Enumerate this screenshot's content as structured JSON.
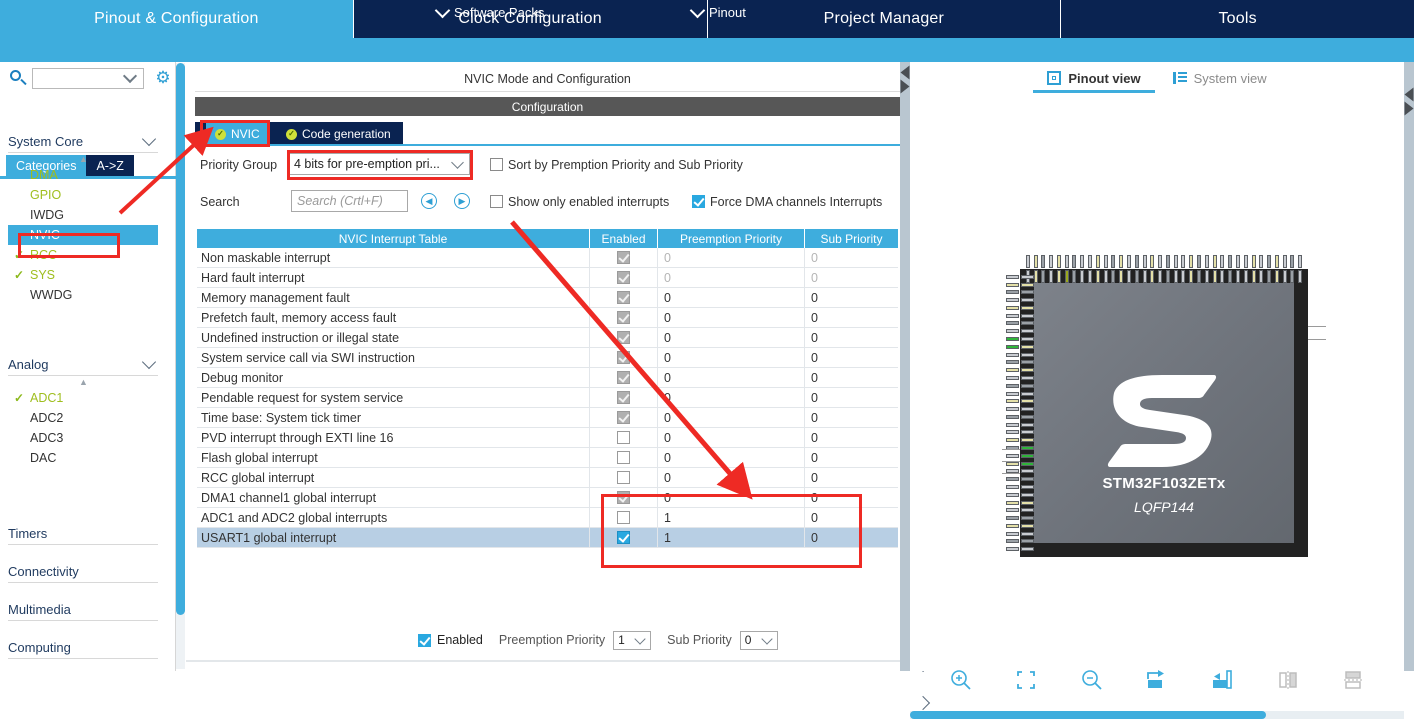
{
  "top_tabs": [
    {
      "label": "Pinout & Configuration",
      "active": true
    },
    {
      "label": "Clock Configuration",
      "active": false
    },
    {
      "label": "Project Manager",
      "active": false
    },
    {
      "label": "Tools",
      "active": false
    }
  ],
  "sub_menu": [
    {
      "label": "Software Packs"
    },
    {
      "label": "Pinout"
    }
  ],
  "sidebar": {
    "search_value": "",
    "gear_icon": "gear-icon",
    "mode_tabs": [
      {
        "label": "Categories",
        "active": true
      },
      {
        "label": "A->Z",
        "active": false
      }
    ],
    "groups": [
      {
        "title": "System Core",
        "expanded": true,
        "items": [
          {
            "label": "DMA",
            "state": "configured-olive",
            "checked": false
          },
          {
            "label": "GPIO",
            "state": "configured-olive",
            "checked": false
          },
          {
            "label": "IWDG",
            "state": "normal",
            "checked": false
          },
          {
            "label": "NVIC",
            "state": "selected",
            "checked": false
          },
          {
            "label": "RCC",
            "state": "configured-olive",
            "checked": true
          },
          {
            "label": "SYS",
            "state": "configured-olive",
            "checked": true
          },
          {
            "label": "WWDG",
            "state": "normal",
            "checked": false
          }
        ]
      },
      {
        "title": "Analog",
        "expanded": true,
        "items": [
          {
            "label": "ADC1",
            "state": "configured-olive",
            "checked": true
          },
          {
            "label": "ADC2",
            "state": "normal",
            "checked": false
          },
          {
            "label": "ADC3",
            "state": "normal",
            "checked": false
          },
          {
            "label": "DAC",
            "state": "normal",
            "checked": false
          }
        ]
      },
      {
        "title": "Timers",
        "expanded": false,
        "items": []
      },
      {
        "title": "Connectivity",
        "expanded": false,
        "items": []
      },
      {
        "title": "Multimedia",
        "expanded": false,
        "items": []
      },
      {
        "title": "Computing",
        "expanded": false,
        "items": []
      }
    ]
  },
  "center": {
    "mode_title": "NVIC Mode and Configuration",
    "configuration_bar": "Configuration",
    "tabs": [
      {
        "label": "NVIC",
        "active": true,
        "status": "ok"
      },
      {
        "label": "Code generation",
        "active": false,
        "status": "ok"
      }
    ],
    "priority_group_label": "Priority Group",
    "priority_group_value": "4 bits for pre-emption pri...",
    "sort_checkbox": {
      "label": "Sort by Premption Priority and Sub Priority",
      "checked": false
    },
    "search_label": "Search",
    "search_placeholder": "Search (Crtl+F)",
    "nav_prev_icon": "chevron-left-circle-icon",
    "nav_next_icon": "chevron-right-circle-icon",
    "show_enabled_checkbox": {
      "label": "Show only enabled interrupts",
      "checked": false
    },
    "force_dma_checkbox": {
      "label": "Force DMA channels Interrupts",
      "checked": true
    },
    "table": {
      "headers": [
        "NVIC Interrupt Table",
        "Enabled",
        "Preemption Priority",
        "Sub Priority"
      ],
      "rows": [
        {
          "name": "Non maskable interrupt",
          "enabled": "locked",
          "preemption": "0",
          "sub": "0",
          "dim": true,
          "selected": false
        },
        {
          "name": "Hard fault interrupt",
          "enabled": "locked",
          "preemption": "0",
          "sub": "0",
          "dim": true,
          "selected": false
        },
        {
          "name": "Memory management fault",
          "enabled": "locked",
          "preemption": "0",
          "sub": "0",
          "dim": false,
          "selected": false
        },
        {
          "name": "Prefetch fault, memory access fault",
          "enabled": "locked",
          "preemption": "0",
          "sub": "0",
          "dim": false,
          "selected": false
        },
        {
          "name": "Undefined instruction or illegal state",
          "enabled": "locked",
          "preemption": "0",
          "sub": "0",
          "dim": false,
          "selected": false
        },
        {
          "name": "System service call via SWI instruction",
          "enabled": "locked",
          "preemption": "0",
          "sub": "0",
          "dim": false,
          "selected": false
        },
        {
          "name": "Debug monitor",
          "enabled": "locked",
          "preemption": "0",
          "sub": "0",
          "dim": false,
          "selected": false
        },
        {
          "name": "Pendable request for system service",
          "enabled": "locked",
          "preemption": "0",
          "sub": "0",
          "dim": false,
          "selected": false
        },
        {
          "name": "Time base: System tick timer",
          "enabled": "locked",
          "preemption": "0",
          "sub": "0",
          "dim": false,
          "selected": false
        },
        {
          "name": "PVD interrupt through EXTI line 16",
          "enabled": "unchecked",
          "preemption": "0",
          "sub": "0",
          "dim": false,
          "selected": false
        },
        {
          "name": "Flash global interrupt",
          "enabled": "unchecked",
          "preemption": "0",
          "sub": "0",
          "dim": false,
          "selected": false
        },
        {
          "name": "RCC global interrupt",
          "enabled": "unchecked",
          "preemption": "0",
          "sub": "0",
          "dim": false,
          "selected": false
        },
        {
          "name": "DMA1 channel1 global interrupt",
          "enabled": "locked",
          "preemption": "0",
          "sub": "0",
          "dim": false,
          "selected": false
        },
        {
          "name": "ADC1 and ADC2 global interrupts",
          "enabled": "unchecked",
          "preemption": "1",
          "sub": "0",
          "dim": false,
          "selected": false
        },
        {
          "name": "USART1 global interrupt",
          "enabled": "checked",
          "preemption": "1",
          "sub": "0",
          "dim": false,
          "selected": true
        }
      ]
    },
    "bottom": {
      "enabled_label": "Enabled",
      "enabled_checked": true,
      "preemption_label": "Preemption Priority",
      "preemption_value": "1",
      "sub_label": "Sub Priority",
      "sub_value": "0"
    }
  },
  "right": {
    "view_tabs": [
      {
        "label": "Pinout view",
        "active": true,
        "icon": "chip-icon"
      },
      {
        "label": "System view",
        "active": false,
        "icon": "system-list-icon"
      }
    ],
    "chip": {
      "name": "STM32F103ZETx",
      "package": "LQFP144",
      "logo": "st-logo"
    },
    "toolbar": [
      {
        "name": "zoom-in-icon",
        "enabled": true
      },
      {
        "name": "fit-to-screen-icon",
        "enabled": true
      },
      {
        "name": "zoom-out-icon",
        "enabled": true
      },
      {
        "name": "rotate-right-icon",
        "enabled": true
      },
      {
        "name": "rotate-left-icon",
        "enabled": true
      },
      {
        "name": "flip-vertical-icon",
        "enabled": false
      },
      {
        "name": "flip-horizontal-icon",
        "enabled": false
      }
    ],
    "progress_percent": 72
  },
  "annotations": {
    "boxes": [
      "nvic-sidebar-item",
      "nvic-tab",
      "priority-group-combo",
      "table-priority-cells"
    ],
    "arrows": [
      "arrow-to-nvic-tab",
      "arrow-to-priority-cells"
    ],
    "color": "#ee2a24"
  }
}
